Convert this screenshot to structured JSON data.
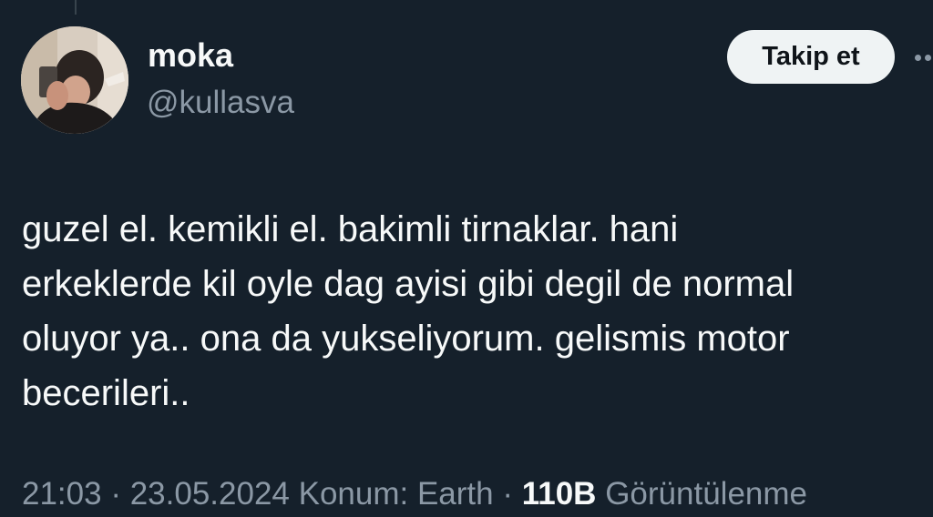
{
  "author": {
    "display_name": "moka",
    "handle": "@kullasva"
  },
  "actions": {
    "follow_label": "Takip et"
  },
  "tweet": {
    "text_lines": [
      "guzel el. kemikli el. bakimli tirnaklar. hani",
      "erkeklerde kil oyle dag ayisi gibi degil de normal",
      "oluyor ya.. ona da yukseliyorum. gelismis motor",
      "becerileri.."
    ]
  },
  "meta": {
    "time": "21:03",
    "separator": " · ",
    "date": "23.05.2024",
    "location": "Konum: Earth",
    "views_count": "110B",
    "views_label": "Görüntülenme"
  },
  "colors": {
    "background": "#15202b",
    "primary_text": "#f7f9f9",
    "secondary_text": "#8b98a5",
    "follow_button_bg": "#eff3f4",
    "follow_button_text": "#0f1419"
  },
  "icons": {
    "more": "more-dots-icon"
  }
}
